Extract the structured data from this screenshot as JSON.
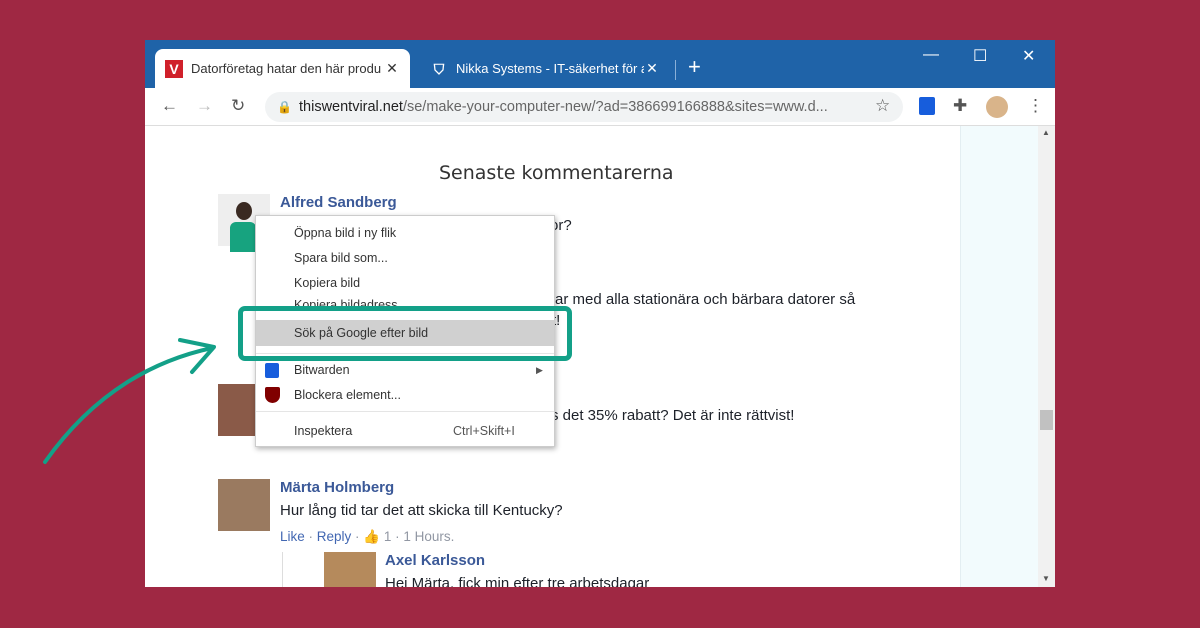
{
  "tabs": [
    {
      "title": "Datorföretag hatar den här produ",
      "favicon": "V",
      "close": "✕"
    },
    {
      "title": "Nikka Systems - IT-säkerhet för a",
      "favicon": "shield-icon",
      "close": "✕"
    }
  ],
  "new_tab": "+",
  "window_controls": {
    "minimize": "—",
    "maximize": "☐",
    "close": "✕"
  },
  "address": {
    "domain": "thiswentviral.net",
    "path": "/se/make-your-computer-new/?ad=386699166888&sites=www.d..."
  },
  "page": {
    "heading": "Senaste kommentarerna",
    "comments": [
      {
        "name": "Alfred Sandberg",
        "fragments": [
          "or?",
          "rar med alla stationära och bärbara datorer så",
          "t!"
        ]
      },
      {
        "fragment": "s det 35% rabatt? Det är inte rättvist!"
      },
      {
        "name": "Märta Holmberg",
        "text": "Hur lång tid tar det att skicka till Kentucky?",
        "like": "Like",
        "reply": "Reply",
        "likes": "1",
        "time": "1 Hours."
      },
      {
        "name": "Axel Karlsson",
        "text": "Hej Märta, fick min efter tre arbetsdagar"
      }
    ]
  },
  "context_menu": {
    "items": [
      "Öppna bild i ny flik",
      "Spara bild som...",
      "Kopiera bild",
      "Kopiera bildadress",
      "Sök på Google efter bild",
      "Bitwarden",
      "Blockera element...",
      "Inspektera"
    ],
    "shortcut": "Ctrl+Skift+I",
    "highlighted": "Sök på Google efter bild"
  },
  "colors": {
    "background": "#9f2843",
    "accent": "#13a088",
    "titlebar": "#1f63a8"
  }
}
